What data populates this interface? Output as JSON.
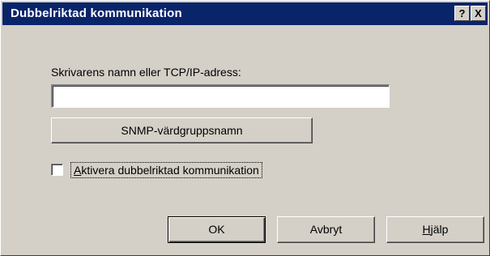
{
  "window": {
    "title": "Dubbelriktad kommunikation"
  },
  "titlebar": {
    "help_symbol": "?",
    "close_symbol": "X"
  },
  "form": {
    "field_label": "Skrivarens namn eller TCP/IP-adress:",
    "field_value": "",
    "snmp_button": "SNMP-värdgruppsnamn",
    "checkbox": {
      "label_mnemonic": "A",
      "label_rest": "ktivera dubbelriktad kommunikation",
      "checked": false
    }
  },
  "buttons": {
    "ok": "OK",
    "cancel": "Avbryt",
    "help_mnemonic": "H",
    "help_rest": "jälp"
  },
  "icons": {
    "help": "help-icon",
    "close": "close-icon"
  }
}
